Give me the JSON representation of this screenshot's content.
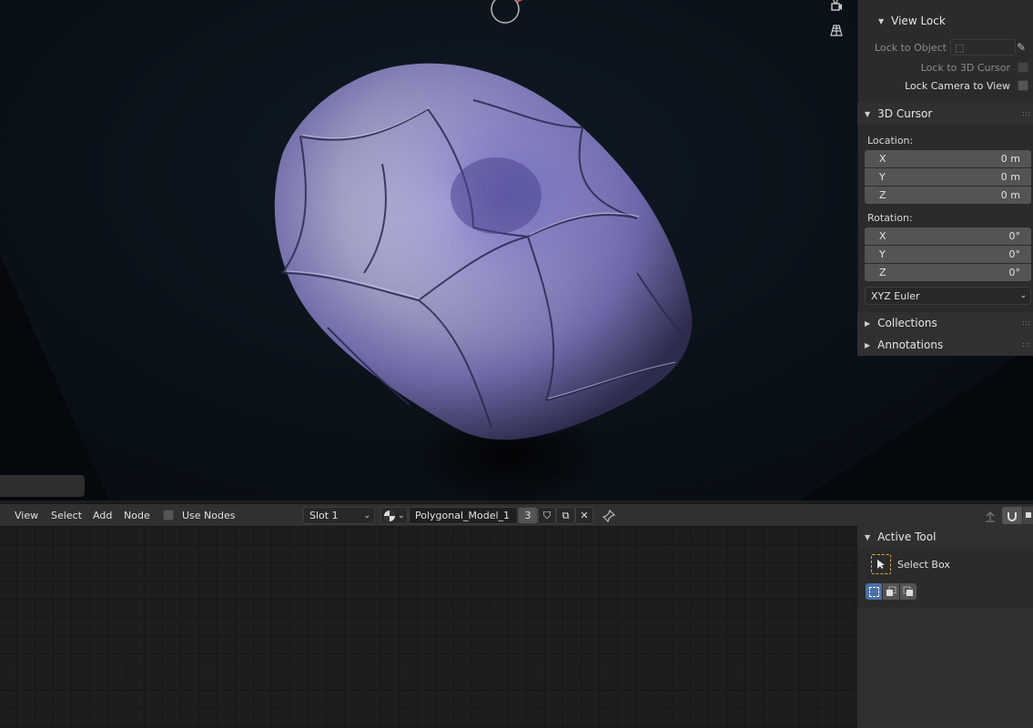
{
  "viewport": {
    "object_colors": {
      "base": "#a9a9c9",
      "tint": "#5c54b8",
      "shadow": "#2e2c4e",
      "highlight": "#e4e4ee"
    }
  },
  "n_panel": {
    "view_lock": {
      "title": "View Lock",
      "lock_to_object_label": "Lock to Object",
      "lock_to_3d_cursor_label": "Lock to 3D Cursor",
      "lock_camera_to_view_label": "Lock Camera to View"
    },
    "cursor": {
      "title": "3D Cursor",
      "location_label": "Location:",
      "location": [
        {
          "axis": "X",
          "value": "0 m"
        },
        {
          "axis": "Y",
          "value": "0 m"
        },
        {
          "axis": "Z",
          "value": "0 m"
        }
      ],
      "rotation_label": "Rotation:",
      "rotation": [
        {
          "axis": "X",
          "value": "0°"
        },
        {
          "axis": "Y",
          "value": "0°"
        },
        {
          "axis": "Z",
          "value": "0°"
        }
      ],
      "rotation_mode": "XYZ Euler"
    },
    "collections_title": "Collections",
    "annotations_title": "Annotations"
  },
  "node_header": {
    "menus": [
      "View",
      "Select",
      "Add",
      "Node"
    ],
    "use_nodes_label": "Use Nodes",
    "slot": "Slot 1",
    "material_name": "Polygonal_Model_1",
    "user_count": "3"
  },
  "node_sidebar": {
    "active_tool_title": "Active Tool",
    "tool_name": "Select Box"
  }
}
